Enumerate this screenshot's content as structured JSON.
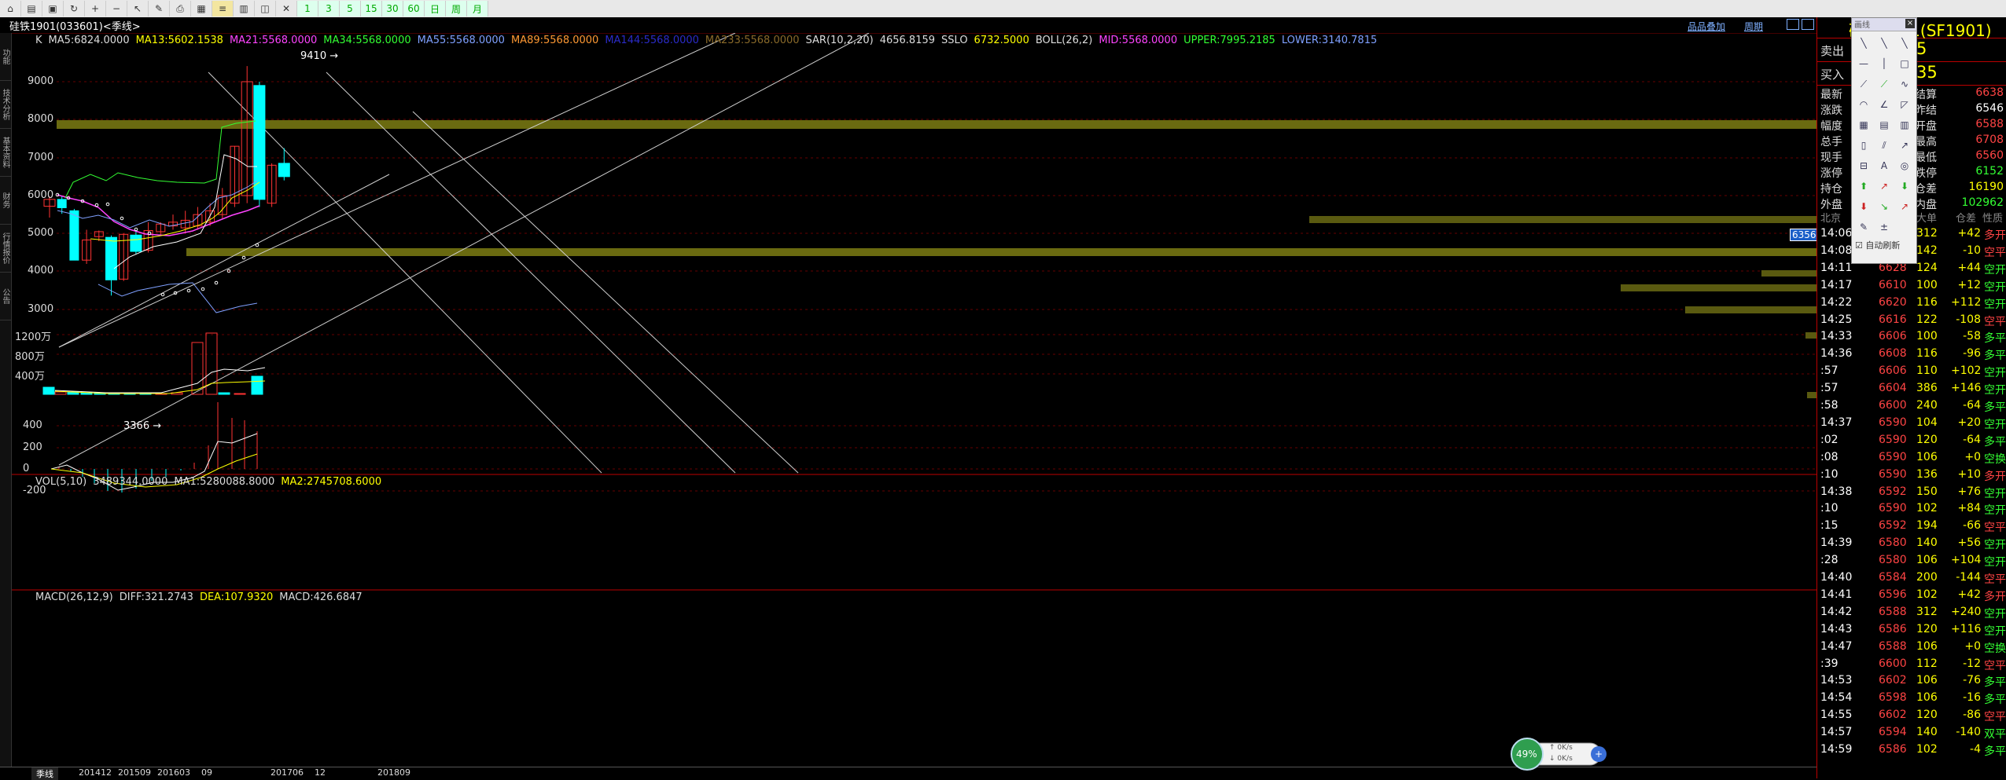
{
  "toolbar": {
    "buttons": [
      "home-icon",
      "folder-icon",
      "save-icon",
      "refresh-icon",
      "zoom-in-icon",
      "zoom-out-icon",
      "pointer-icon",
      "pen-icon",
      "print-icon",
      "grid-icon",
      "menu-icon",
      "bar-icon",
      "chart-icon",
      "cross-icon",
      "1",
      "3",
      "5",
      "15",
      "30",
      "60",
      "日",
      "周",
      "月"
    ]
  },
  "title": "硅铁1901(033601)<季线>",
  "top_links": {
    "add": "品品叠加",
    "period": "周期"
  },
  "side_tabs": [
    "功能",
    "技术分析",
    "基本资料",
    "财务",
    "行情报价",
    "公告"
  ],
  "indicators": {
    "main": [
      {
        "text": "K",
        "color": "#dddddd"
      },
      {
        "text": "MA5:6824.0000",
        "color": "#dddddd"
      },
      {
        "text": "MA13:5602.1538",
        "color": "#ffff00"
      },
      {
        "text": "MA21:5568.0000",
        "color": "#ff44ff"
      },
      {
        "text": "MA34:5568.0000",
        "color": "#33ff33"
      },
      {
        "text": "MA55:5568.0000",
        "color": "#7fa0ff"
      },
      {
        "text": "MA89:5568.0000",
        "color": "#ff9933"
      },
      {
        "text": "MA144:5568.0000",
        "color": "#2b2bc8"
      },
      {
        "text": "MA233:5568.0000",
        "color": "#8a6a2a"
      },
      {
        "text": "SAR(10,2,20)",
        "color": "#dddddd"
      },
      {
        "text": "4656.8159",
        "color": "#dddddd"
      },
      {
        "text": "SSLO",
        "color": "#dddddd"
      },
      {
        "text": "6732.5000",
        "color": "#ffff00"
      },
      {
        "text": "BOLL(26,2)",
        "color": "#dddddd"
      },
      {
        "text": "MID:5568.0000",
        "color": "#ff44ff"
      },
      {
        "text": "UPPER:7995.2185",
        "color": "#33ff33"
      },
      {
        "text": "LOWER:3140.7815",
        "color": "#7fa0ff"
      }
    ],
    "vol": [
      {
        "text": "VOL(5,10)",
        "color": "#dddddd"
      },
      {
        "text": "3489344.0000",
        "color": "#dddddd"
      },
      {
        "text": "MA1:5280088.8000",
        "color": "#dddddd"
      },
      {
        "text": "MA2:2745708.6000",
        "color": "#ffff00"
      }
    ],
    "macd": [
      {
        "text": "MACD(26,12,9)",
        "color": "#dddddd"
      },
      {
        "text": "DIFF:321.2743",
        "color": "#dddddd"
      },
      {
        "text": "DEA:107.9320",
        "color": "#ffff00"
      },
      {
        "text": "MACD:426.6847",
        "color": "#dddddd"
      }
    ]
  },
  "y_main": [
    "9000",
    "8000",
    "7000",
    "6000",
    "5000",
    "4000",
    "3000"
  ],
  "y_vol": [
    "1200万",
    "800万",
    "400万"
  ],
  "y_macd": [
    "400",
    "200",
    "0",
    "-200"
  ],
  "price_marks": {
    "high": "9410",
    "low": "3366",
    "current": "6356"
  },
  "x_labels": [
    "201412",
    "201509",
    "201603",
    "09",
    "201706",
    "12",
    "201809"
  ],
  "period_tab": "季线",
  "quote": {
    "symbol": "硅铁1901(SF1901)",
    "sell_label": "卖出",
    "sell_val": "5",
    "buy_label": "买入",
    "buy_val": "35",
    "rows": [
      {
        "l1": "最新",
        "v1": "",
        "l2": "结算",
        "v2": "6638",
        "c2": "#ff4444"
      },
      {
        "l1": "涨跌",
        "v1": "",
        "l2": "昨结",
        "v2": "6546",
        "c2": "#ffffff"
      },
      {
        "l1": "幅度",
        "v1": "",
        "l2": "开盘",
        "v2": "6588",
        "c2": "#ff4444"
      },
      {
        "l1": "总手",
        "v1": "",
        "l2": "最高",
        "v2": "6708",
        "c2": "#ff4444"
      },
      {
        "l1": "现手",
        "v1": "",
        "l2": "最低",
        "v2": "6560",
        "c2": "#ff4444"
      },
      {
        "l1": "涨停",
        "v1": "",
        "l2": "跌停",
        "v2": "6152",
        "c2": "#33ff33"
      },
      {
        "l1": "持仓",
        "v1": "",
        "l2": "仓差",
        "v2": "16190",
        "c2": "#ffff00"
      },
      {
        "l1": "外盘",
        "v1": "",
        "l2": "内盘",
        "v2": "102962",
        "c2": "#33ff33"
      }
    ],
    "tick_header": {
      "c1": "北京",
      "c2": "大单",
      "c3": "仓差",
      "c4": "性质"
    },
    "ticks": [
      {
        "t": "14:06",
        "p": "",
        "v": "312",
        "d": "+42",
        "n": "多开",
        "pc": "#ff4444",
        "nc": "#ff4444"
      },
      {
        "t": "14:08",
        "p": "",
        "v": "142",
        "d": "-10",
        "n": "空平",
        "pc": "#ff4444",
        "nc": "#ff4444"
      },
      {
        "t": "14:11",
        "p": "6628",
        "v": "124",
        "d": "+44",
        "n": "空开",
        "pc": "#ff4444",
        "nc": "#33ff33"
      },
      {
        "t": "14:17",
        "p": "6610",
        "v": "100",
        "d": "+12",
        "n": "空开",
        "pc": "#ff4444",
        "nc": "#33ff33"
      },
      {
        "t": "14:22",
        "p": "6620",
        "v": "116",
        "d": "+112",
        "n": "空开",
        "pc": "#ff4444",
        "nc": "#33ff33"
      },
      {
        "t": "14:25",
        "p": "6616",
        "v": "122",
        "d": "-108",
        "n": "空平",
        "pc": "#ff4444",
        "nc": "#ff4444"
      },
      {
        "t": "14:33",
        "p": "6606",
        "v": "100",
        "d": "-58",
        "n": "多平",
        "pc": "#ff4444",
        "nc": "#33ff33"
      },
      {
        "t": "14:36",
        "p": "6608",
        "v": "116",
        "d": "-96",
        "n": "多平",
        "pc": "#ff4444",
        "nc": "#33ff33"
      },
      {
        "t": ":57",
        "p": "6606",
        "v": "110",
        "d": "+102",
        "n": "空开",
        "pc": "#ff4444",
        "nc": "#33ff33"
      },
      {
        "t": ":57",
        "p": "6604",
        "v": "386",
        "d": "+146",
        "n": "空开",
        "pc": "#ff4444",
        "nc": "#33ff33"
      },
      {
        "t": ":58",
        "p": "6600",
        "v": "240",
        "d": "-64",
        "n": "多平",
        "pc": "#ff4444",
        "nc": "#33ff33"
      },
      {
        "t": "14:37",
        "p": "6590",
        "v": "104",
        "d": "+20",
        "n": "空开",
        "pc": "#ff4444",
        "nc": "#33ff33"
      },
      {
        "t": ":02",
        "p": "6590",
        "v": "120",
        "d": "-64",
        "n": "多平",
        "pc": "#ff4444",
        "nc": "#33ff33"
      },
      {
        "t": ":08",
        "p": "6590",
        "v": "106",
        "d": "+0",
        "n": "空换",
        "pc": "#ff4444",
        "nc": "#33ff33"
      },
      {
        "t": ":10",
        "p": "6590",
        "v": "136",
        "d": "+10",
        "n": "多开",
        "pc": "#ff4444",
        "nc": "#ff4444"
      },
      {
        "t": "14:38",
        "p": "6592",
        "v": "150",
        "d": "+76",
        "n": "空开",
        "pc": "#ff4444",
        "nc": "#33ff33"
      },
      {
        "t": ":10",
        "p": "6590",
        "v": "102",
        "d": "+84",
        "n": "空开",
        "pc": "#ff4444",
        "nc": "#33ff33"
      },
      {
        "t": ":15",
        "p": "6592",
        "v": "194",
        "d": "-66",
        "n": "空平",
        "pc": "#ff4444",
        "nc": "#ff4444"
      },
      {
        "t": "14:39",
        "p": "6580",
        "v": "140",
        "d": "+56",
        "n": "空开",
        "pc": "#ff4444",
        "nc": "#33ff33"
      },
      {
        "t": ":28",
        "p": "6580",
        "v": "106",
        "d": "+104",
        "n": "空开",
        "pc": "#ff4444",
        "nc": "#33ff33"
      },
      {
        "t": "14:40",
        "p": "6584",
        "v": "200",
        "d": "-144",
        "n": "空平",
        "pc": "#ff4444",
        "nc": "#ff4444"
      },
      {
        "t": "14:41",
        "p": "6596",
        "v": "102",
        "d": "+42",
        "n": "多开",
        "pc": "#ff4444",
        "nc": "#ff4444"
      },
      {
        "t": "14:42",
        "p": "6588",
        "v": "312",
        "d": "+240",
        "n": "空开",
        "pc": "#ff4444",
        "nc": "#33ff33"
      },
      {
        "t": "14:43",
        "p": "6586",
        "v": "120",
        "d": "+116",
        "n": "空开",
        "pc": "#ff4444",
        "nc": "#33ff33"
      },
      {
        "t": "14:47",
        "p": "6588",
        "v": "106",
        "d": "+0",
        "n": "空换",
        "pc": "#ff4444",
        "nc": "#33ff33"
      },
      {
        "t": ":39",
        "p": "6600",
        "v": "112",
        "d": "-12",
        "n": "空平",
        "pc": "#ff4444",
        "nc": "#ff4444"
      },
      {
        "t": "14:53",
        "p": "6602",
        "v": "106",
        "d": "-76",
        "n": "多平",
        "pc": "#ff4444",
        "nc": "#33ff33"
      },
      {
        "t": "14:54",
        "p": "6598",
        "v": "106",
        "d": "-16",
        "n": "多平",
        "pc": "#ff4444",
        "nc": "#33ff33"
      },
      {
        "t": "14:55",
        "p": "6602",
        "v": "120",
        "d": "-86",
        "n": "空平",
        "pc": "#ff4444",
        "nc": "#ff4444"
      },
      {
        "t": "14:57",
        "p": "6594",
        "v": "140",
        "d": "-140",
        "n": "双平",
        "pc": "#ff4444",
        "nc": "#33ff33"
      },
      {
        "t": "14:59",
        "p": "6586",
        "v": "102",
        "d": "-4",
        "n": "多平",
        "pc": "#ff4444",
        "nc": "#33ff33"
      }
    ]
  },
  "draw_palette": {
    "title": "画线",
    "tools": [
      "line-icon",
      "ray-icon",
      "channel-icon",
      "hline-icon",
      "vline-icon",
      "rect-icon",
      "segment-icon",
      "arrow-line-icon",
      "wave-icon",
      "arc-icon",
      "angle-icon",
      "fan-icon",
      "gann-icon",
      "fib-icon",
      "percent-icon",
      "cycle-icon",
      "parallel-icon",
      "speed-icon",
      "regress-icon",
      "text-icon",
      "ellipse-icon",
      "up-arrow-icon",
      "up-right-arrow-icon",
      "down-arrow-icon",
      "down-icon",
      "down-right-icon",
      "up-right-icon",
      "pencil-icon",
      "plus-minus-icon"
    ],
    "auto_label": "自动刷新"
  },
  "net": {
    "pct": "49%",
    "up": "0K/s",
    "down": "0K/s"
  }
}
